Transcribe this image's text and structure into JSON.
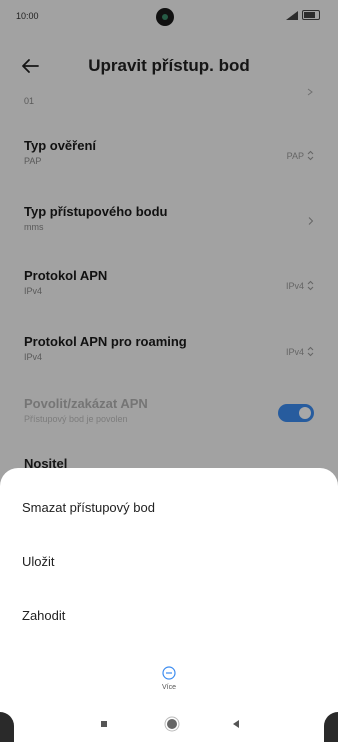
{
  "status_bar": {
    "time": "10:00"
  },
  "app_bar": {
    "title": "Upravit přístup. bod"
  },
  "settings": {
    "previous_value": "01",
    "rows": [
      {
        "title": "Typ ověření",
        "subtitle": "PAP",
        "value": "PAP"
      },
      {
        "title": "Typ přístupového bodu",
        "subtitle": "mms",
        "value": ""
      },
      {
        "title": "Protokol APN",
        "subtitle": "IPv4",
        "value": "IPv4"
      },
      {
        "title": "Protokol APN pro roaming",
        "subtitle": "IPv4",
        "value": "IPv4"
      },
      {
        "title": "Povolit/zakázat APN",
        "subtitle": "Přístupový bod je povolen",
        "toggle_on": true
      }
    ],
    "partial_row": "Nositel"
  },
  "menu": {
    "items": [
      {
        "label": "Smazat přístupový bod"
      },
      {
        "label": "Uložit"
      },
      {
        "label": "Zahodit"
      }
    ],
    "more_label": "Více"
  },
  "colors": {
    "accent": "#3c8cf0",
    "overlay": "rgba(0,0,0,0.34)",
    "sheet_bg": "#ffffff"
  }
}
